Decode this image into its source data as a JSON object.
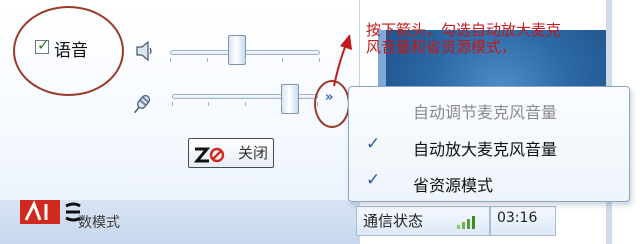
{
  "panel": {
    "voice_checkbox_label": "语音",
    "voice_checked": true,
    "speaker_volume_percent": 44,
    "mic_volume_percent": 85,
    "close_button_label": "关闭",
    "expand_chevron": "»"
  },
  "annotation": {
    "line1": "按下箭头，勾选自动放大麦克",
    "line2": "风音量和省资源模式，"
  },
  "menu": {
    "items": [
      {
        "label": "自动调节麦克风音量",
        "checked": false,
        "enabled": false
      },
      {
        "label": "自动放大麦克风音量",
        "checked": true,
        "enabled": true
      },
      {
        "label": "省资源模式",
        "checked": true,
        "enabled": true
      }
    ]
  },
  "statusbar": {
    "left_text": "数模式",
    "status_label": "通信状态",
    "time": "03:16"
  },
  "colors": {
    "annotation_red": "#c21a1a",
    "ellipse_red": "#9a3b2a",
    "check_blue": "#2e5e9a",
    "chevron_blue": "#3a63b8"
  },
  "icons": [
    "checkmark-icon",
    "speaker-icon",
    "microphone-icon",
    "chevron-double-right-icon",
    "signal-bars-icon",
    "arrow-up-icon"
  ]
}
